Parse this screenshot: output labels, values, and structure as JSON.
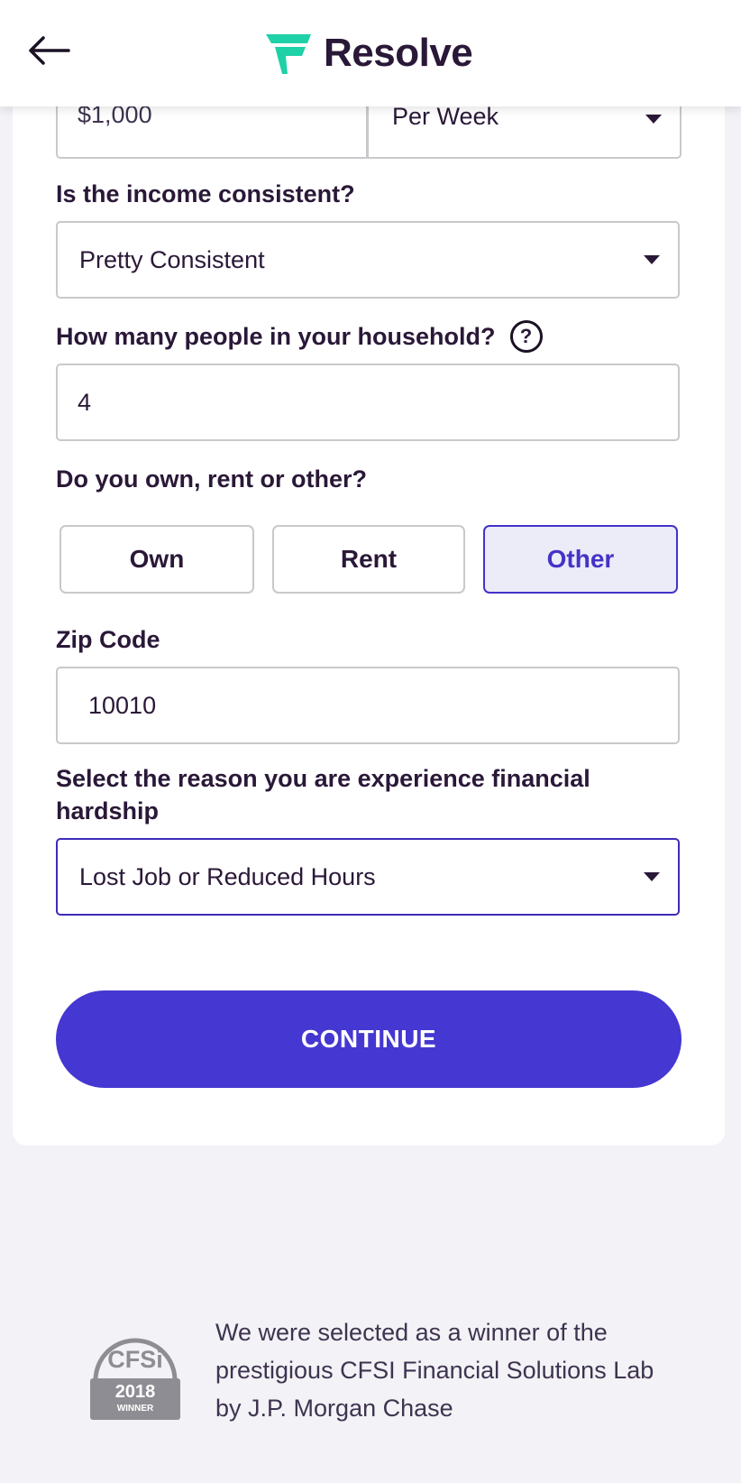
{
  "header": {
    "logo_text": "Resolve"
  },
  "income": {
    "amount": "$1,000",
    "frequency": "Per Week"
  },
  "consistency": {
    "label": "Is the income consistent?",
    "value": "Pretty Consistent"
  },
  "household": {
    "label": "How many people in your household?",
    "value": "4"
  },
  "housing": {
    "label": "Do you own, rent or other?",
    "options": [
      "Own",
      "Rent",
      "Other"
    ],
    "selected": "Other"
  },
  "zip": {
    "label": "Zip Code",
    "value": "10010"
  },
  "hardship": {
    "label": "Select the reason you are experience financial hardship",
    "value": "Lost Job or Reduced Hours"
  },
  "continue_label": "CONTINUE",
  "footer": {
    "badge_name": "CFSi",
    "badge_year": "2018",
    "badge_caption": "WINNER",
    "text": "We were selected as a winner of the prestigious CFSI Financial Solutions Lab by J.P. Morgan Chase"
  },
  "colors": {
    "accent": "#4537d1",
    "text": "#2a1838",
    "logo_green": "#1fd1a6"
  }
}
